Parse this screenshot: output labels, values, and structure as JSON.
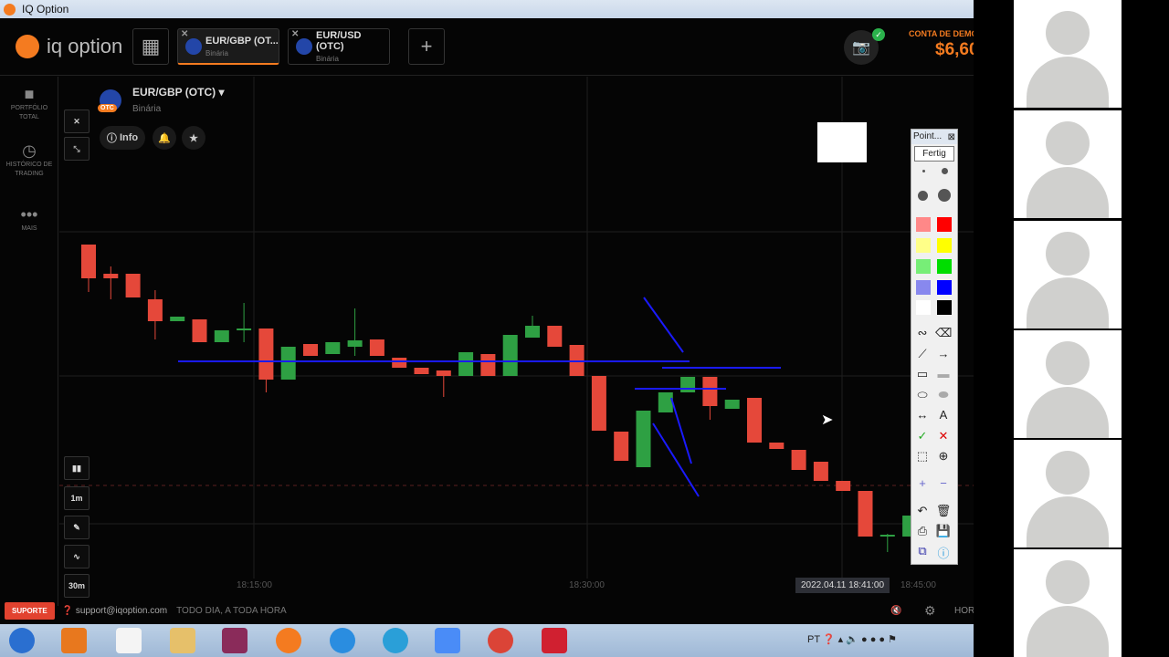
{
  "window": {
    "title": "IQ Option"
  },
  "header": {
    "logo": "iq option",
    "tabs": [
      {
        "label": "EUR/GBP (OT...",
        "sub": "Binária",
        "active": true
      },
      {
        "label": "EUR/USD (OTC)",
        "sub": "Binária",
        "active": false
      }
    ],
    "account_label": "CONTA DE DEMO",
    "balance": "$6,60"
  },
  "sidebar": {
    "items": [
      {
        "label": "PORTFÓLIO TOTAL",
        "icon": "briefcase-icon"
      },
      {
        "label": "HISTÓRICO DE TRADING",
        "icon": "history-icon"
      },
      {
        "label": "MAIS",
        "icon": "more-icon"
      }
    ]
  },
  "asset": {
    "name": "EUR/GBP (OTC)",
    "type": "Binária",
    "otc_badge": "OTC",
    "info": "Info"
  },
  "chart_tools": {
    "interval": "1m",
    "range": "30m"
  },
  "time_axis": {
    "labels": [
      "18:15:00",
      "18:30:00",
      "18:45:00"
    ],
    "cursor_time": "2022.04.11 18:41:00"
  },
  "footer": {
    "support": "SUPORTE",
    "email": "support@iqoption.com",
    "hours": "TODO DIA, A TODA HORA",
    "right": "HOR"
  },
  "pointer_tool": {
    "title": "Point...",
    "done": "Fertig"
  },
  "taskbar": {
    "lang": "PT"
  },
  "colors": {
    "up": "#2ea043",
    "down": "#e5483a",
    "accent": "#f47b20",
    "annotation": "#1a1aff"
  },
  "chart_data": {
    "type": "candlestick",
    "candles": [
      [
        35.2,
        31.5,
        35.2,
        30
      ],
      [
        32.0,
        31.5,
        32.8,
        29.2
      ],
      [
        32.0,
        29.4,
        32.0,
        29.4
      ],
      [
        29.2,
        26.8,
        30.2,
        24.8
      ],
      [
        26.8,
        27.3,
        27.3,
        26.8
      ],
      [
        27.0,
        24.5,
        27.0,
        24.5
      ],
      [
        24.5,
        25.8,
        25.8,
        24.5
      ],
      [
        25.8,
        26.0,
        28.8,
        24.5
      ],
      [
        26.0,
        20.4,
        26.0,
        19.0
      ],
      [
        20.4,
        24.0,
        24.0,
        20.4
      ],
      [
        24.3,
        23.0,
        24.3,
        23.0
      ],
      [
        23.2,
        24.5,
        24.5,
        23.2
      ],
      [
        24.0,
        24.7,
        28.2,
        23.0
      ],
      [
        24.8,
        23.0,
        24.8,
        23.0
      ],
      [
        22.8,
        21.7,
        22.8,
        21.7
      ],
      [
        21.7,
        21.0,
        21.7,
        21.0
      ],
      [
        21.4,
        20.8,
        21.4,
        18.5
      ],
      [
        20.8,
        23.4,
        23.4,
        20.8
      ],
      [
        23.2,
        20.8,
        23.2,
        20.8
      ],
      [
        20.8,
        25.3,
        25.3,
        20.8
      ],
      [
        25.0,
        26.3,
        27.4,
        25.0
      ],
      [
        26.3,
        24.0,
        26.3,
        24.0
      ],
      [
        24.2,
        20.8,
        24.2,
        20.8
      ],
      [
        20.8,
        14.8,
        20.8,
        14.8
      ],
      [
        14.7,
        11.5,
        14.7,
        11.5
      ],
      [
        10.8,
        17.0,
        17.0,
        10.8
      ],
      [
        16.8,
        19.0,
        19.0,
        16.8
      ],
      [
        19.0,
        20.7,
        20.7,
        19.0
      ],
      [
        20.7,
        17.5,
        20.7,
        16.0
      ],
      [
        17.2,
        18.2,
        18.2,
        17.2
      ],
      [
        18.4,
        13.5,
        18.4,
        13.5
      ],
      [
        13.5,
        12.8,
        13.5,
        12.8
      ],
      [
        12.7,
        10.5,
        12.7,
        10.5
      ],
      [
        11.4,
        9.3,
        11.4,
        9.3
      ],
      [
        9.3,
        8.2,
        9.3,
        8.2
      ],
      [
        8.2,
        3.2,
        8.2,
        3.2
      ],
      [
        3.4,
        3.4,
        3.5,
        1.5
      ],
      [
        3.2,
        5.5,
        5.5,
        3.2
      ]
    ]
  }
}
